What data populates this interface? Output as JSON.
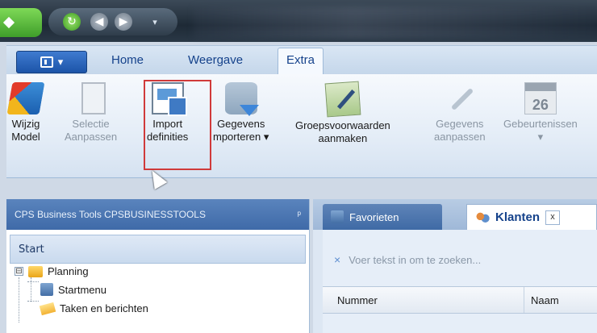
{
  "ribbon": {
    "tabs": [
      "Home",
      "Weergave",
      "Extra"
    ],
    "active_tab": "Extra",
    "buttons": [
      {
        "line1": "Wijzig",
        "line2": "Model",
        "enabled": true,
        "icon": "model-cubes-icon"
      },
      {
        "line1": "Selectie",
        "line2": "Aanpassen",
        "enabled": false,
        "icon": "selection-icon"
      },
      {
        "line1": "Import",
        "line2": "definities",
        "enabled": true,
        "icon": "import-definitions-icon"
      },
      {
        "line1": "Gegevens",
        "line2": "mporteren ▾",
        "enabled": true,
        "icon": "database-import-icon"
      },
      {
        "line1": "Groepsvoorwaarden",
        "line2": "aanmaken",
        "enabled": true,
        "icon": "pen-document-icon"
      },
      {
        "line1": "Gegevens",
        "line2": "aanpassen",
        "enabled": false,
        "icon": "wrench-icon"
      },
      {
        "line1": "Gebeurtenissen",
        "line2": "▾",
        "enabled": false,
        "icon": "calendar-icon"
      }
    ],
    "calendar_number": "26"
  },
  "left_panel": {
    "title": "CPS Business Tools CPSBUSINESSTOOLS",
    "pin": "ᵖ",
    "start": "Start",
    "tree": [
      {
        "label": "Planning",
        "level": 0,
        "expander": "⊟"
      },
      {
        "label": "Startmenu",
        "level": 1
      },
      {
        "label": "Taken en berichten",
        "level": 1
      }
    ]
  },
  "right_panel": {
    "tabs": [
      {
        "label": "Favorieten"
      },
      {
        "label": "Klanten",
        "close": "x"
      }
    ],
    "search_placeholder": "Voer tekst in om te zoeken...",
    "search_clear": "×",
    "columns": [
      "Nummer",
      "Naam"
    ]
  },
  "colors": {
    "accent": "#15428b",
    "highlight_border": "#d03a3a"
  }
}
